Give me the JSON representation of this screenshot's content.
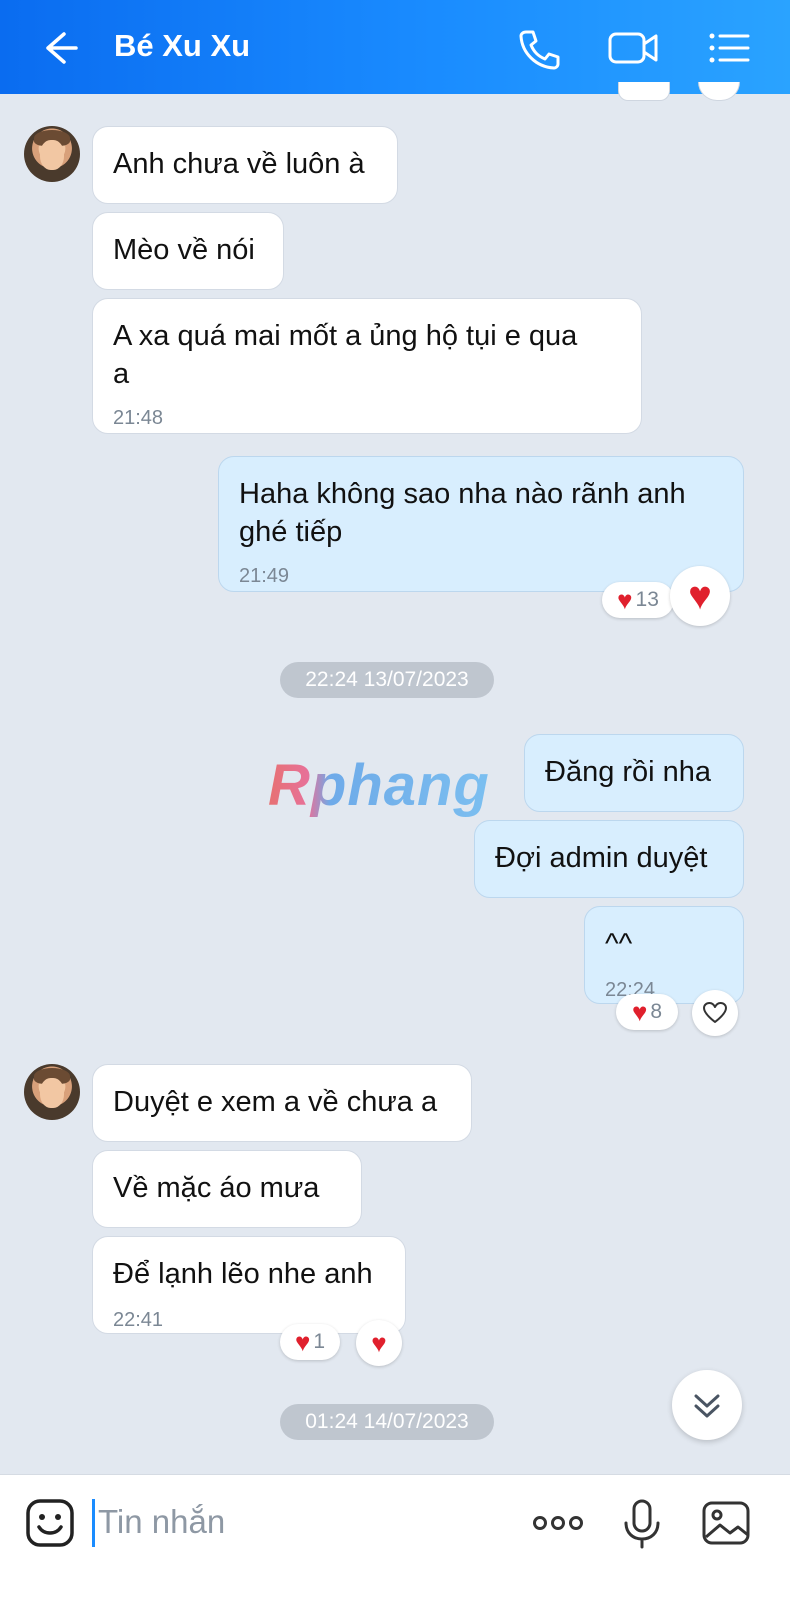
{
  "header": {
    "title": "Bé Xu Xu",
    "icons": [
      "back-arrow-icon",
      "phone-icon",
      "video-call-icon",
      "menu-list-icon"
    ]
  },
  "messages": {
    "m1": {
      "text": "Anh chưa về luôn à"
    },
    "m2": {
      "text": "Mèo về nói"
    },
    "m3": {
      "line1": "A xa quá mai mốt a ủng hộ tụi e qua",
      "line2": "a",
      "time": "21:48"
    },
    "m4": {
      "line1": "Haha không sao nha nào rãnh anh",
      "line2": "ghé tiếp",
      "time": "21:49",
      "reaction_count": "13"
    },
    "date1": "22:24 13/07/2023",
    "m5": {
      "text": "Đăng rồi nha"
    },
    "m6": {
      "text": "Đợi admin duyệt"
    },
    "m7": {
      "text": "^^",
      "time": "22:24",
      "reaction_count": "8"
    },
    "m8": {
      "text": "Duyệt e xem a về chưa a"
    },
    "m9": {
      "text": "Về mặc áo mưa"
    },
    "m10": {
      "text": "Để lạnh lẽo nhe anh",
      "time": "22:41",
      "reaction_count": "1"
    },
    "date2": "01:24 14/07/2023"
  },
  "watermark": "Rphang",
  "input": {
    "placeholder": "Tin nhắn"
  },
  "colors": {
    "header": "#1a8cff",
    "incoming_bubble": "#ffffff",
    "outgoing_bubble": "#d8eefe",
    "heart": "#e0202d"
  }
}
